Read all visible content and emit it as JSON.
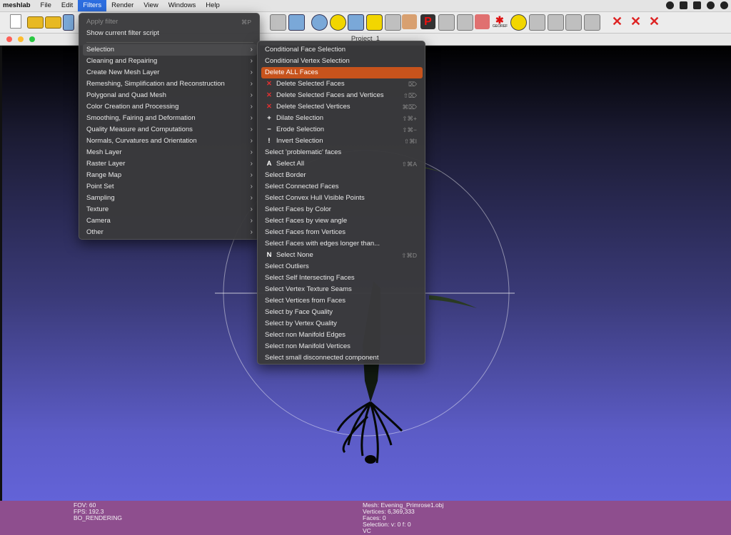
{
  "menubar": {
    "app": "meshlab",
    "items": [
      "File",
      "Edit",
      "Filters",
      "Render",
      "View",
      "Windows",
      "Help"
    ],
    "active": "Filters"
  },
  "window": {
    "title": "Project_1"
  },
  "filters_menu": {
    "apply_filter": "Apply filter",
    "apply_filter_shortcut": "⌘P",
    "show_script": "Show current filter script",
    "categories": [
      "Selection",
      "Cleaning and Repairing",
      "Create New Mesh Layer",
      "Remeshing, Simplification and Reconstruction",
      "Polygonal and Quad Mesh",
      "Color Creation and Processing",
      "Smoothing, Fairing and Deformation",
      "Quality Measure and Computations",
      "Normals, Curvatures and Orientation",
      "Mesh Layer",
      "Raster Layer",
      "Range Map",
      "Point Set",
      "Sampling",
      "Texture",
      "Camera",
      "Other"
    ]
  },
  "selection_submenu": {
    "items": [
      {
        "label": "Conditional Face Selection",
        "icon": "",
        "shortcut": ""
      },
      {
        "label": "Conditional Vertex Selection",
        "icon": "",
        "shortcut": ""
      },
      {
        "label": "Delete ALL Faces",
        "icon": "",
        "shortcut": ""
      },
      {
        "label": "Delete Selected Faces",
        "icon": "delete-faces-icon",
        "shortcut": "⌦"
      },
      {
        "label": "Delete Selected Faces and Vertices",
        "icon": "delete-faces-vertices-icon",
        "shortcut": "⇧⌦"
      },
      {
        "label": "Delete Selected Vertices",
        "icon": "delete-vertices-icon",
        "shortcut": "⌘⌦"
      },
      {
        "label": "Dilate Selection",
        "icon": "dilate-icon",
        "shortcut": "⇧⌘+"
      },
      {
        "label": "Erode Selection",
        "icon": "erode-icon",
        "shortcut": "⇧⌘−"
      },
      {
        "label": "Invert Selection",
        "icon": "invert-icon",
        "shortcut": "⇧⌘I"
      },
      {
        "label": "Select 'problematic' faces",
        "icon": "",
        "shortcut": ""
      },
      {
        "label": "Select All",
        "icon": "select-all-icon",
        "shortcut": "⇧⌘A"
      },
      {
        "label": "Select Border",
        "icon": "",
        "shortcut": ""
      },
      {
        "label": "Select Connected Faces",
        "icon": "",
        "shortcut": ""
      },
      {
        "label": "Select Convex Hull Visible Points",
        "icon": "",
        "shortcut": ""
      },
      {
        "label": "Select Faces by Color",
        "icon": "",
        "shortcut": ""
      },
      {
        "label": "Select Faces by view angle",
        "icon": "",
        "shortcut": ""
      },
      {
        "label": "Select Faces from Vertices",
        "icon": "",
        "shortcut": ""
      },
      {
        "label": "Select Faces with edges longer than...",
        "icon": "",
        "shortcut": ""
      },
      {
        "label": "Select None",
        "icon": "select-none-icon",
        "shortcut": "⇧⌘D"
      },
      {
        "label": "Select Outliers",
        "icon": "",
        "shortcut": ""
      },
      {
        "label": "Select Self Intersecting Faces",
        "icon": "",
        "shortcut": ""
      },
      {
        "label": "Select Vertex Texture Seams",
        "icon": "",
        "shortcut": ""
      },
      {
        "label": "Select Vertices from Faces",
        "icon": "",
        "shortcut": ""
      },
      {
        "label": "Select by Face Quality",
        "icon": "",
        "shortcut": ""
      },
      {
        "label": "Select by Vertex Quality",
        "icon": "",
        "shortcut": ""
      },
      {
        "label": "Select non Manifold Edges",
        "icon": "",
        "shortcut": ""
      },
      {
        "label": "Select non Manifold Vertices",
        "icon": "",
        "shortcut": ""
      },
      {
        "label": "Select small disconnected component",
        "icon": "",
        "shortcut": ""
      }
    ],
    "highlighted": "Delete ALL Faces"
  },
  "status": {
    "fov": "FOV: 60",
    "fps": "FPS:   192.3",
    "rendering": "BO_RENDERING",
    "mesh": "Mesh: Evening_Primrose1.obj",
    "vertices": "Vertices: 6,369,333",
    "faces": "Faces: 0",
    "selection": "Selection: v: 0 f: 0",
    "vc": "VC"
  },
  "toolbar": {
    "georef_label": "GEOREF"
  },
  "colors": {
    "accent": "#c7531c",
    "status_bg": "#8e4e8e",
    "viewport_bottom": "#6363d8"
  }
}
